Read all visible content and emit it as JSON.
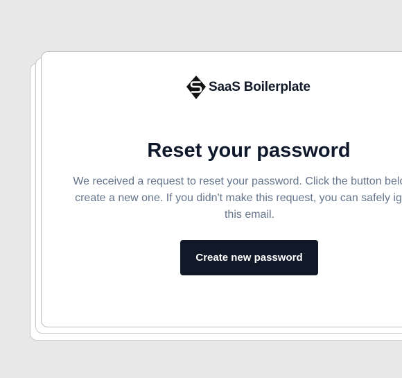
{
  "brand": {
    "name": "SaaS Boilerplate",
    "logo_icon": "saas-s-diamond-icon"
  },
  "email": {
    "heading": "Reset your password",
    "body": "We received a request to reset your password. Click the button below to create a new one. If you didn't make this request, you can safely ignore this email.",
    "cta_label": "Create new password"
  },
  "colors": {
    "background": "#e8e8e8",
    "card": "#ffffff",
    "heading": "#0f172a",
    "body_text": "#64748b",
    "button": "#111827",
    "button_text": "#ffffff"
  }
}
